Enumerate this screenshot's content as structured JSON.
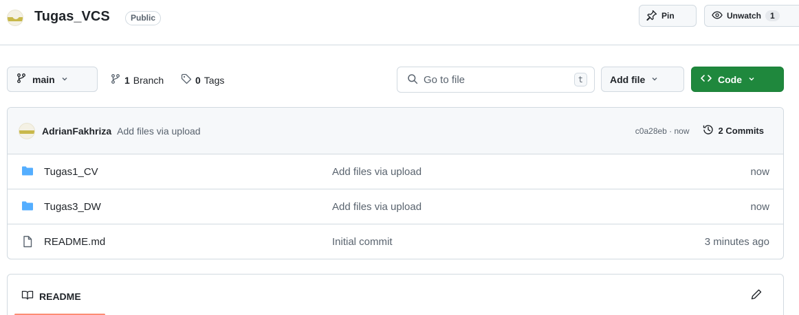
{
  "repo": {
    "name": "Tugas_VCS",
    "visibility": "Public",
    "pin_label": "Pin",
    "watch_label": "Unwatch",
    "watch_count": "1"
  },
  "toolbar": {
    "branch": "main",
    "branch_count": "1",
    "branch_label": "Branch",
    "tag_count": "0",
    "tag_label": "Tags",
    "search_placeholder": "Go to file",
    "search_shortcut": "t",
    "add_file_label": "Add file",
    "code_label": "Code"
  },
  "latest_commit": {
    "author": "AdrianFakhriza",
    "message": "Add files via upload",
    "sha_time": "c0a28eb · now",
    "commits_label": "2 Commits"
  },
  "files": [
    {
      "name": "Tugas1_CV",
      "type": "folder",
      "message": "Add files via upload",
      "age": "now"
    },
    {
      "name": "Tugas3_DW",
      "type": "folder",
      "message": "Add files via upload",
      "age": "now"
    },
    {
      "name": "README.md",
      "type": "file",
      "message": "Initial commit",
      "age": "3 minutes ago"
    }
  ],
  "readme": {
    "title": "README"
  },
  "colors": {
    "primary_button": "#1f883d",
    "folder_icon": "#54aeff",
    "border": "#d1d9e0",
    "readme_tab_underline": "#fd8c73"
  }
}
